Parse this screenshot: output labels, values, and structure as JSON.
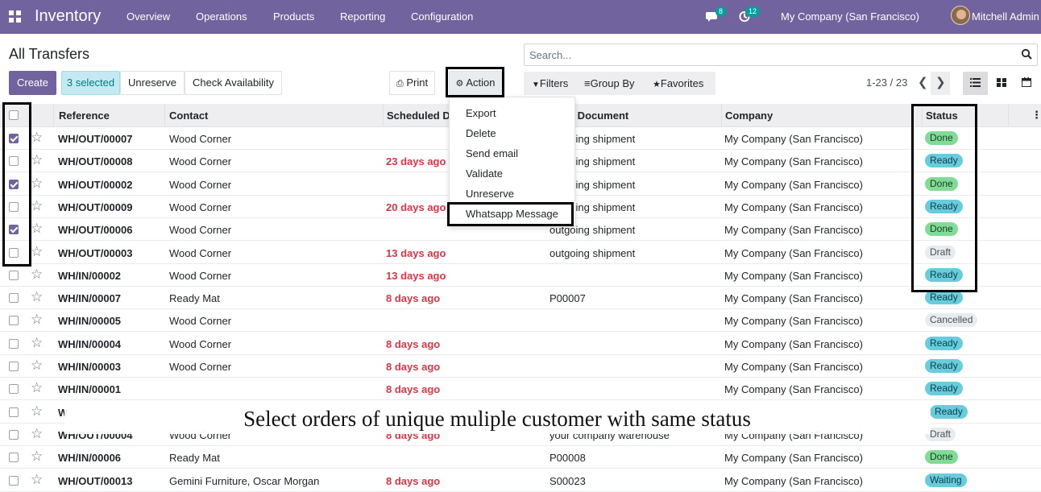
{
  "navbar": {
    "app_name": "Inventory",
    "menu": [
      "Overview",
      "Operations",
      "Products",
      "Reporting",
      "Configuration"
    ],
    "chat_badge": "8",
    "activity_badge": "12",
    "company": "My Company (San Francisco)",
    "user": "Mitchell Admin"
  },
  "control": {
    "title": "All Transfers",
    "create": "Create",
    "selected": "3 selected",
    "unreserve": "Unreserve",
    "check_availability": "Check Availability",
    "print": "Print",
    "action": "Action",
    "search_placeholder": "Search...",
    "filters": "Filters",
    "group_by": "Group By",
    "favorites": "Favorites",
    "pager": "1-23 / 23"
  },
  "columns": [
    "Reference",
    "Contact",
    "Scheduled Date",
    "Source Document",
    "Company",
    "Status"
  ],
  "action_menu": [
    "Export",
    "Delete",
    "Send email",
    "Validate",
    "Unreserve",
    "Whatsapp Message"
  ],
  "rows": [
    {
      "ref": "WH/OUT/00007",
      "contact": "Wood Corner",
      "date": "",
      "source": "outgoing shipment",
      "company": "My Company (San Francisco)",
      "status": "Done",
      "checked": true
    },
    {
      "ref": "WH/OUT/00008",
      "contact": "Wood Corner",
      "date": "23 days ago",
      "source": "outgoing shipment",
      "company": "My Company (San Francisco)",
      "status": "Ready",
      "checked": false
    },
    {
      "ref": "WH/OUT/00002",
      "contact": "Wood Corner",
      "date": "",
      "source": "outgoing shipment",
      "company": "My Company (San Francisco)",
      "status": "Done",
      "checked": true
    },
    {
      "ref": "WH/OUT/00009",
      "contact": "Wood Corner",
      "date": "20 days ago",
      "source": "outgoing shipment",
      "company": "My Company (San Francisco)",
      "status": "Ready",
      "checked": false
    },
    {
      "ref": "WH/OUT/00006",
      "contact": "Wood Corner",
      "date": "",
      "source": "outgoing shipment",
      "company": "My Company (San Francisco)",
      "status": "Done",
      "checked": true
    },
    {
      "ref": "WH/OUT/00003",
      "contact": "Wood Corner",
      "date": "13 days ago",
      "source": "outgoing shipment",
      "company": "My Company (San Francisco)",
      "status": "Draft",
      "checked": false
    },
    {
      "ref": "WH/IN/00002",
      "contact": "Wood Corner",
      "date": "13 days ago",
      "source": "",
      "company": "My Company (San Francisco)",
      "status": "Ready",
      "checked": false
    },
    {
      "ref": "WH/IN/00007",
      "contact": "Ready Mat",
      "date": "8 days ago",
      "source": "P00007",
      "company": "My Company (San Francisco)",
      "status": "Ready",
      "checked": false
    },
    {
      "ref": "WH/IN/00005",
      "contact": "Wood Corner",
      "date": "",
      "source": "",
      "company": "My Company (San Francisco)",
      "status": "Cancelled",
      "checked": false
    },
    {
      "ref": "WH/IN/00004",
      "contact": "Wood Corner",
      "date": "8 days ago",
      "source": "",
      "company": "My Company (San Francisco)",
      "status": "Ready",
      "checked": false
    },
    {
      "ref": "WH/IN/00003",
      "contact": "Wood Corner",
      "date": "8 days ago",
      "source": "",
      "company": "My Company (San Francisco)",
      "status": "Ready",
      "checked": false
    },
    {
      "ref": "WH/IN/00001",
      "contact": "",
      "date": "8 days ago",
      "source": "",
      "company": "My Company (San Francisco)",
      "status": "Ready",
      "checked": false
    },
    {
      "ref": "W",
      "contact": "",
      "date": "",
      "source": "",
      "company": "",
      "status": "Ready",
      "checked": false
    },
    {
      "ref": "WH/OUT/00004",
      "contact": "Wood Corner",
      "date": "8 days ago",
      "source": "your company warehouse",
      "company": "My Company (San Francisco)",
      "status": "Draft",
      "checked": false
    },
    {
      "ref": "WH/IN/00006",
      "contact": "Ready Mat",
      "date": "",
      "source": "P00008",
      "company": "My Company (San Francisco)",
      "status": "Done",
      "checked": false
    },
    {
      "ref": "WH/OUT/00013",
      "contact": "Gemini Furniture, Oscar Morgan",
      "date": "8 days ago",
      "source": "S00023",
      "company": "My Company (San Francisco)",
      "status": "Waiting",
      "checked": false
    }
  ],
  "caption": "Select orders of unique muliple customer with same status"
}
